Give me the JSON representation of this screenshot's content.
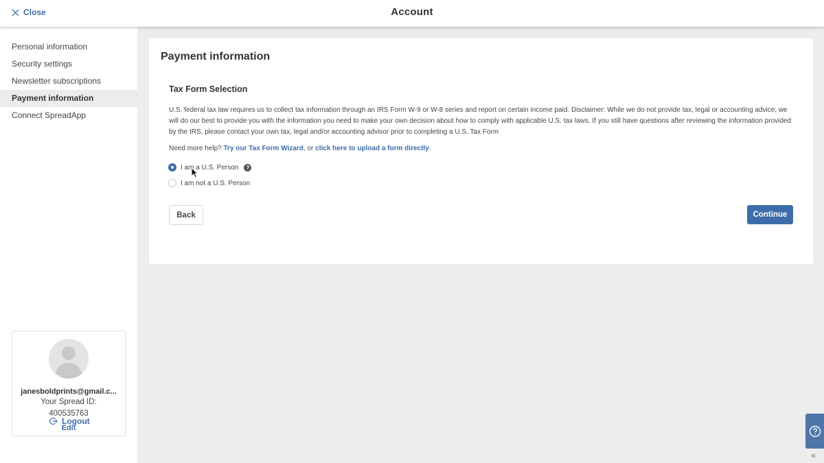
{
  "header": {
    "close_label": "Close",
    "title": "Account"
  },
  "sidebar": {
    "items": [
      {
        "label": "Personal information",
        "active": false
      },
      {
        "label": "Security settings",
        "active": false
      },
      {
        "label": "Newsletter subscriptions",
        "active": false
      },
      {
        "label": "Payment information",
        "active": true
      },
      {
        "label": "Connect SpreadApp",
        "active": false
      }
    ],
    "profile": {
      "email": "janesboldprints@gmail.c...",
      "spread_id_label": "Your Spread ID:",
      "spread_id": "400535763",
      "edit_label": "Edit"
    },
    "logout_label": "Logout"
  },
  "main": {
    "title": "Payment information",
    "section_title": "Tax Form Selection",
    "disclaimer": "U.S. federal tax law requires us to collect tax information through an IRS Form W-9 or W-8 series and report on certain income paid. Disclaimer: While we do not provide tax, legal or accounting advice, we will do our best to provide you with the information you need to make your own decision about how to comply with applicable U.S. tax laws. If you still have questions after reviewing the information provided by the IRS, please contact your own tax, legal and/or accounting advisor prior to completing a U.S. Tax Form",
    "help_prefix": "Need more help?",
    "wizard_link": "Try our Tax Form Wizard",
    "help_middle": ", or",
    "upload_link": "click here to upload a form directly",
    "help_suffix": ".",
    "options": [
      {
        "label": "I am a U.S. Person",
        "checked": true
      },
      {
        "label": "I am not a U.S. Person",
        "checked": false
      }
    ],
    "back_label": "Back",
    "continue_label": "Continue"
  },
  "help_widget_icon": "question-circle-icon",
  "colors": {
    "accent": "#3d6da8",
    "background": "#ededed"
  }
}
